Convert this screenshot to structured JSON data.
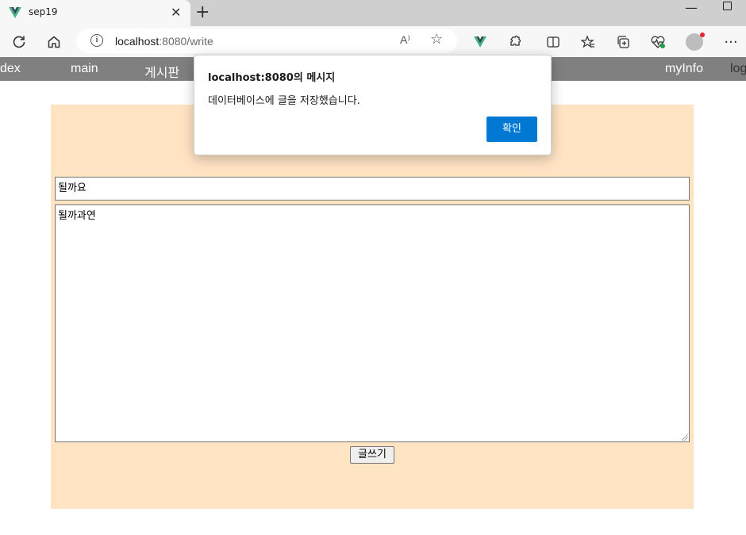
{
  "browser": {
    "tab_title": "sep19",
    "tab_close": "✕",
    "new_tab": "+",
    "url_host": "localhost",
    "url_path": ":8080/write",
    "read_aloud": "A⁾",
    "accent": "#0078d4"
  },
  "nav": {
    "items": [
      "dex",
      "main",
      "게시판",
      "myInfo",
      "log"
    ]
  },
  "form": {
    "title_value": "될까요",
    "content_value": "될까과연",
    "submit_label": "글쓰기",
    "panel_color": "#ffe4c4"
  },
  "dialog": {
    "title": "localhost:8080의 메시지",
    "message": "데이터베이스에 글을 저장했습니다.",
    "ok_label": "확인"
  }
}
